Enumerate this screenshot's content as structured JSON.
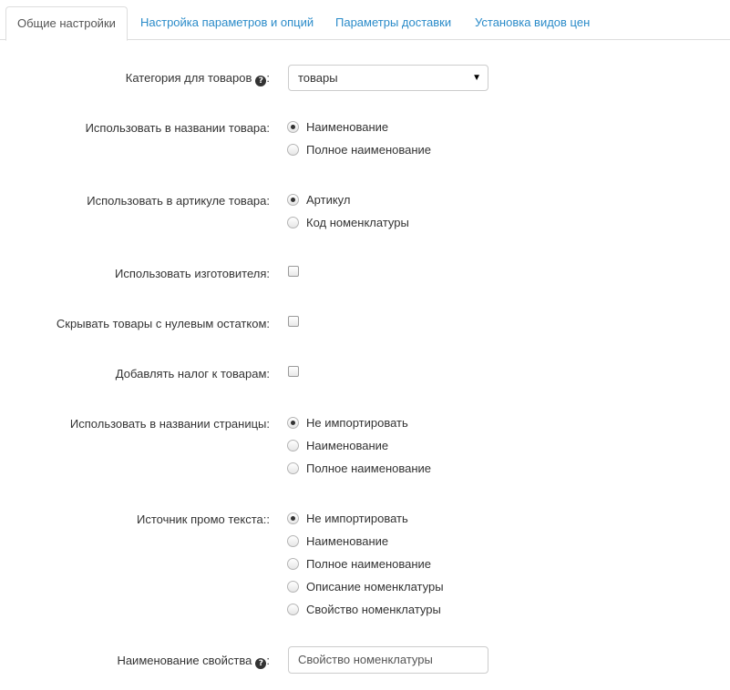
{
  "tabs": [
    {
      "label": "Общие настройки",
      "active": true
    },
    {
      "label": "Настройка параметров и опций",
      "active": false
    },
    {
      "label": "Параметры доставки",
      "active": false
    },
    {
      "label": "Установка видов цен",
      "active": false
    }
  ],
  "category": {
    "label": "Категория для товаров",
    "suffix": ":",
    "value": "товары"
  },
  "product_name": {
    "label": "Использовать в названии товара:",
    "options": [
      "Наименование",
      "Полное наименование"
    ],
    "selected": "Наименование"
  },
  "article": {
    "label": "Использовать в артикуле товара:",
    "options": [
      "Артикул",
      "Код номенклатуры"
    ],
    "selected": "Артикул"
  },
  "use_manufacturer": {
    "label": "Использовать изготовителя:",
    "checked": false
  },
  "hide_zero_stock": {
    "label": "Скрывать товары с нулевым остатком:",
    "checked": false
  },
  "add_tax": {
    "label": "Добавлять налог к товарам:",
    "checked": false
  },
  "page_name": {
    "label": "Использовать в названии страницы:",
    "options": [
      "Не импортировать",
      "Наименование",
      "Полное наименование"
    ],
    "selected": "Не импортировать"
  },
  "promo_source": {
    "label": "Источник промо текста::",
    "options": [
      "Не импортировать",
      "Наименование",
      "Полное наименование",
      "Описание номенклатуры",
      "Свойство номенклатуры"
    ],
    "selected": "Не импортировать"
  },
  "property_name": {
    "label": "Наименование свойства",
    "suffix": ":",
    "value": "Свойство номенклатуры"
  },
  "icons": {
    "help": "help-circle-icon",
    "dropdown": "caret-down-icon"
  }
}
